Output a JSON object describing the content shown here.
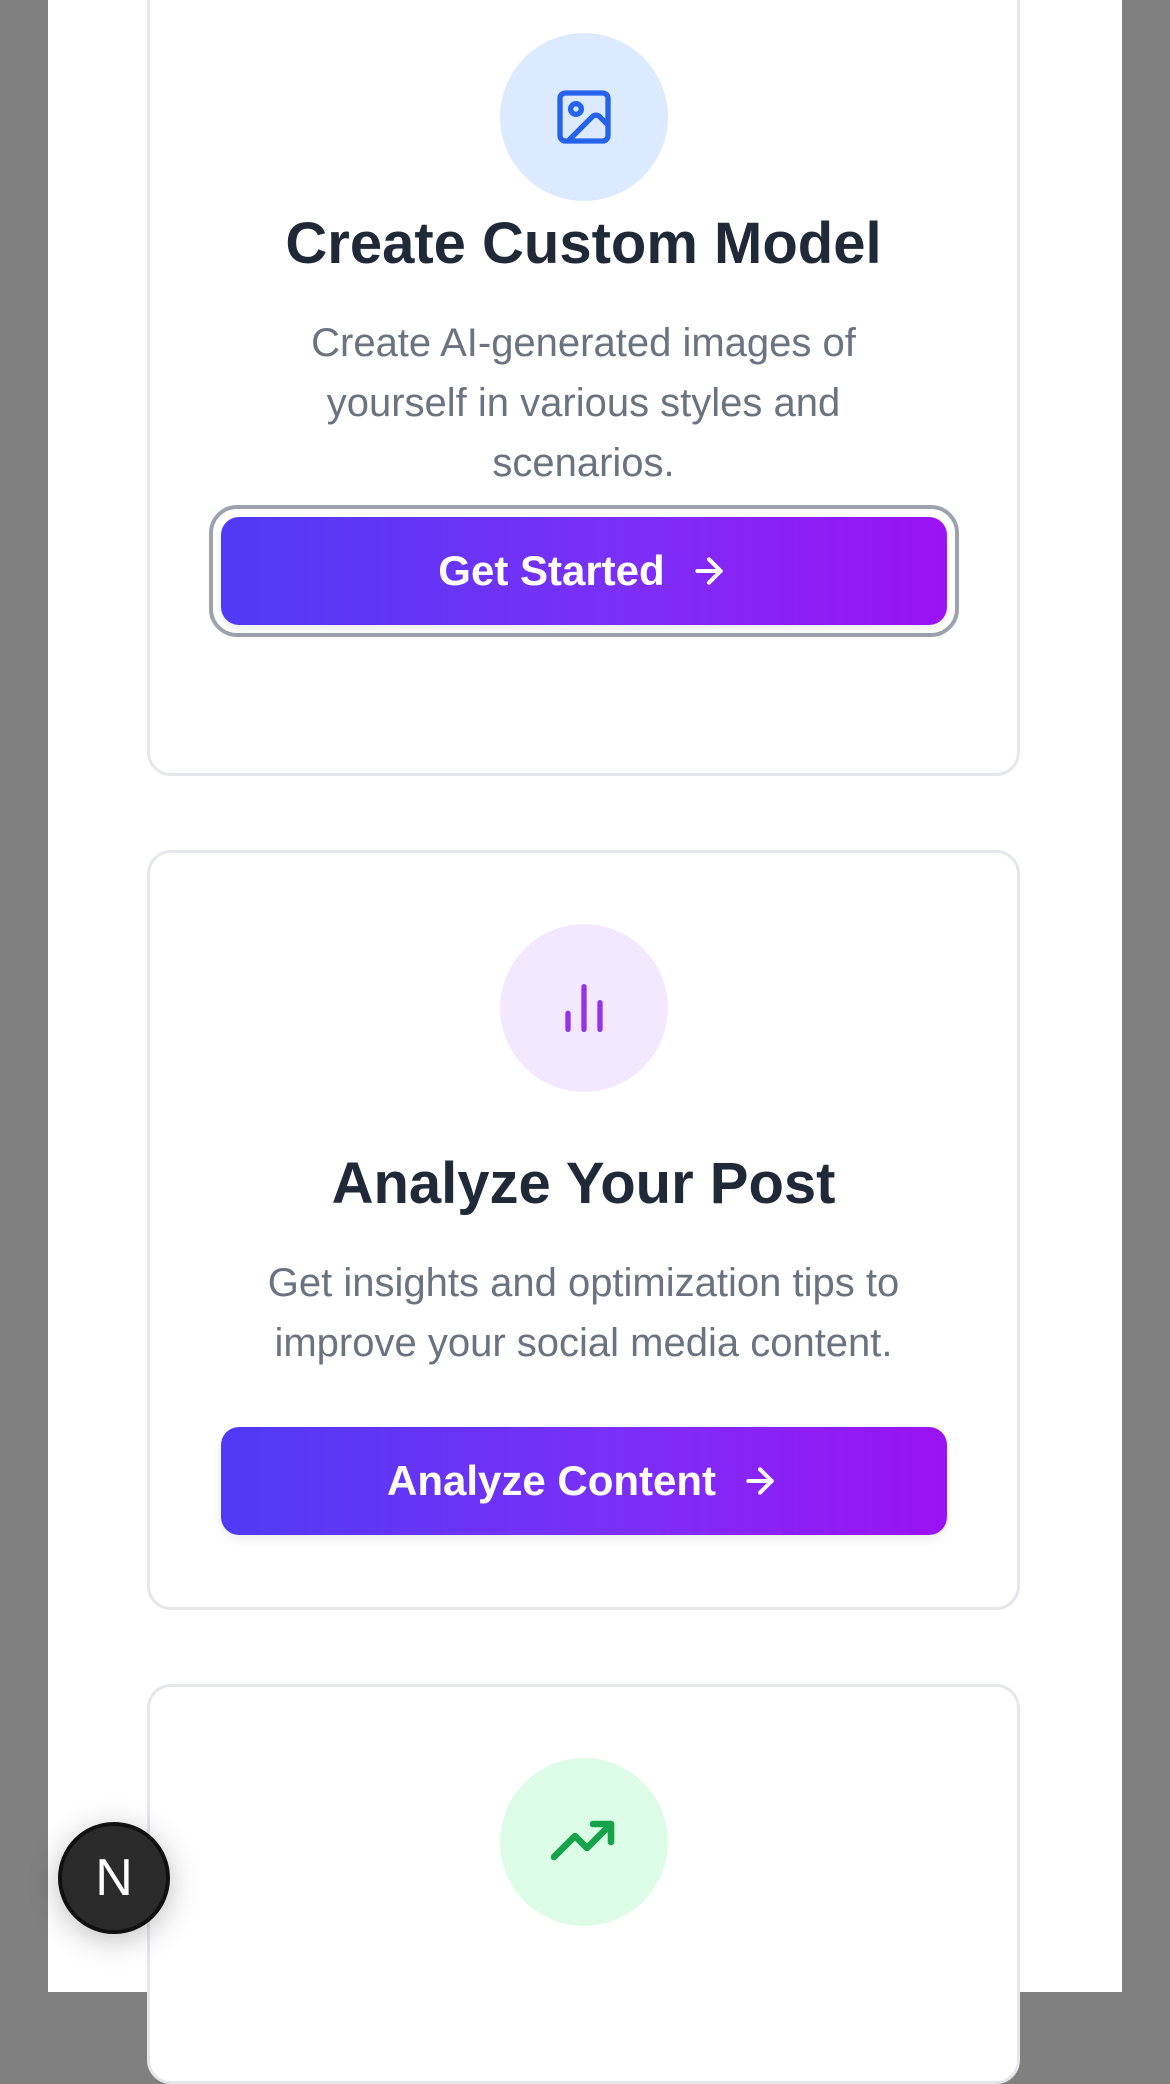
{
  "cards": [
    {
      "icon": "image-icon",
      "icon_color": "#2563eb",
      "circle_color": "#dbeafe",
      "title": "Create Custom Model",
      "description": "Create AI-generated images of yourself in various styles and scenarios.",
      "button_label": "Get Started",
      "focused": true
    },
    {
      "icon": "bar-chart-icon",
      "icon_color": "#9333ea",
      "circle_color": "#f3e8ff",
      "title": "Analyze Your Post",
      "description": "Get insights and optimization tips to improve your social media content.",
      "button_label": "Analyze Content",
      "focused": false
    },
    {
      "icon": "trending-up-icon",
      "icon_color": "#16a34a",
      "circle_color": "#dcfce7"
    }
  ],
  "dev_badge": {
    "label": "N"
  }
}
